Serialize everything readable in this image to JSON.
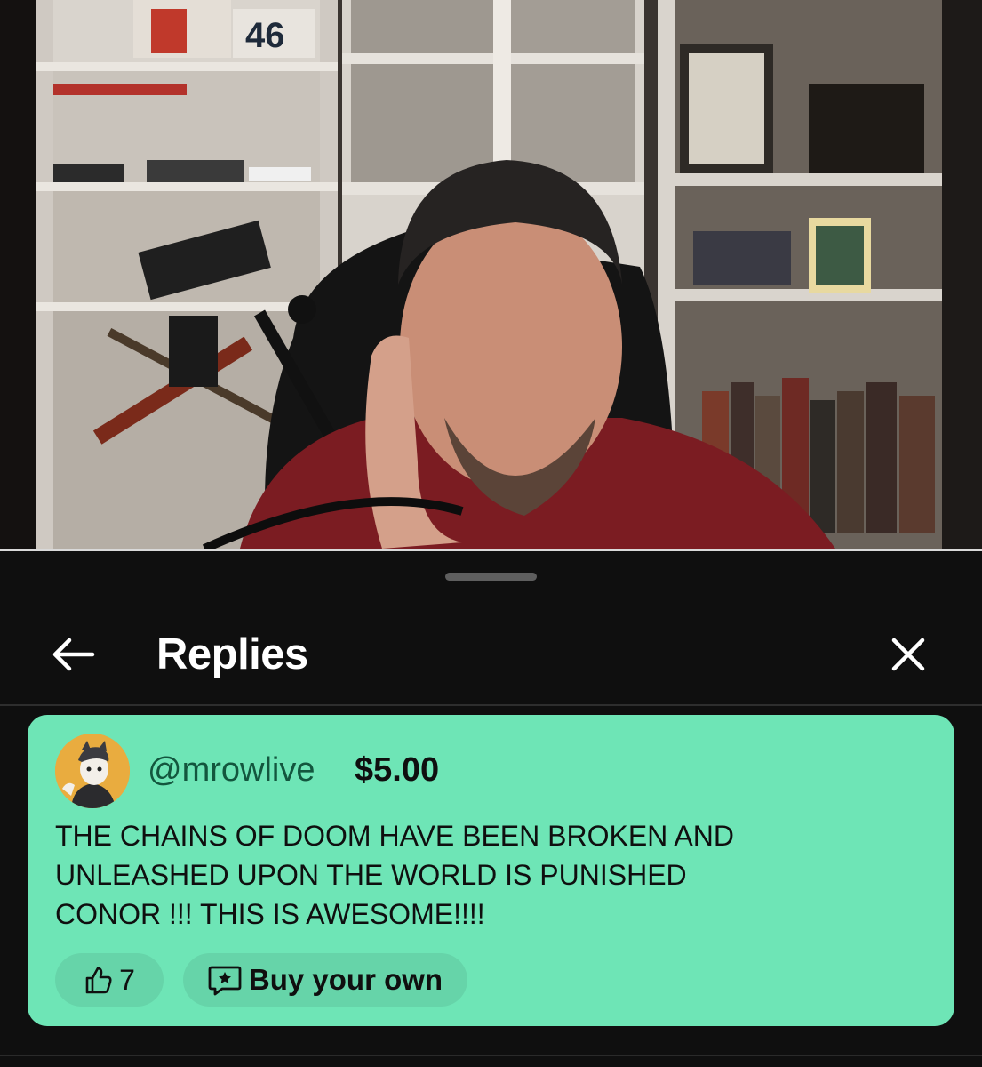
{
  "video": {
    "shelf_number": "46"
  },
  "header": {
    "title": "Replies",
    "back_icon": "arrow-left-icon",
    "close_icon": "close-icon"
  },
  "comment": {
    "handle": "@mrowlive",
    "amount": "$5.00",
    "message_lines": [
      "THE CHAINS OF DOOM HAVE BEEN BROKEN AND",
      "UNLEASHED UPON THE WORLD IS PUNISHED",
      "CONOR !!! THIS IS AWESOME!!!!"
    ],
    "like_count": "7",
    "buy_label": "Buy your own",
    "card_color": "#6ee5b6"
  }
}
